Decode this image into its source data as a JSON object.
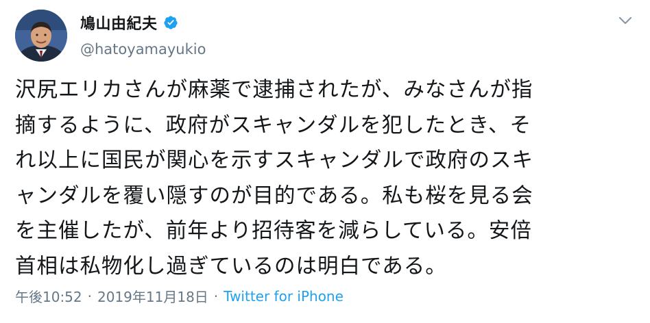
{
  "tweet": {
    "display_name": "鳩山由紀夫",
    "handle": "@hatoyamayukio",
    "verified_icon": "verified-badge-icon",
    "menu_icon": "chevron-down-icon",
    "text": "沢尻エリカさんが麻薬で逮捕されたが、みなさんが指\n摘するように、政府がスキャンダルを犯したとき、そ\nれ以上に国民が関心を示すスキャンダルで政府のスキ\nャンダルを覆い隠すのが目的である。私も桜を見る会\nを主催したが、前年より招待客を減らしている。安倍\n首相は私物化し過ぎているのは明白である。",
    "time": "午後10:52",
    "separator": "·",
    "date": "2019年11月18日",
    "source": "Twitter for iPhone"
  },
  "colors": {
    "accent": "#1da1f2",
    "text": "#14171a",
    "secondary_text": "#657786",
    "background": "#ffffff"
  }
}
